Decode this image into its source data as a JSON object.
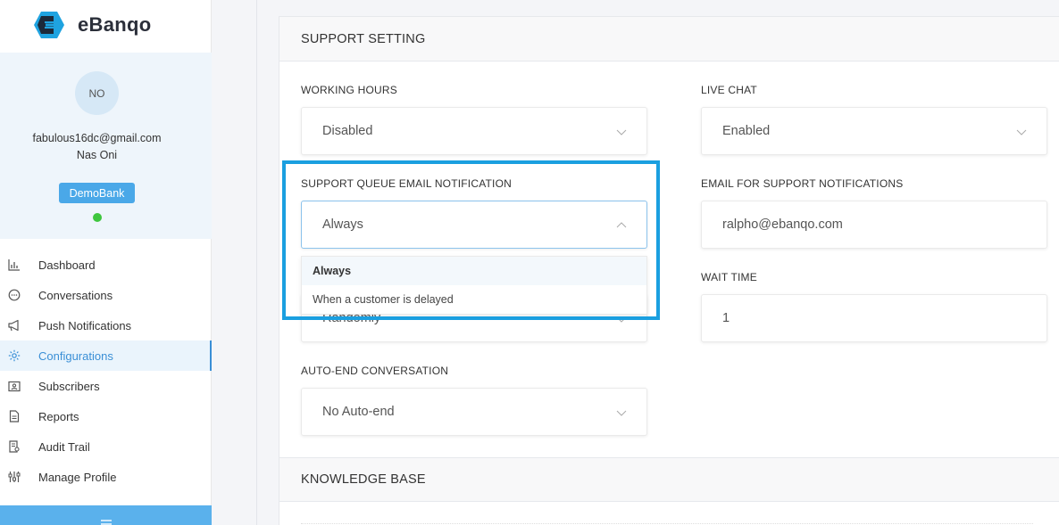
{
  "brand": {
    "name": "eBanqo"
  },
  "profile": {
    "initials": "NO",
    "email": "fabulous16dc@gmail.com",
    "name": "Nas Oni",
    "bank": "DemoBank",
    "status_color": "#3ec63e"
  },
  "nav": {
    "items": [
      {
        "label": "Dashboard",
        "icon": "bar-chart-icon"
      },
      {
        "label": "Conversations",
        "icon": "chat-bubble-icon"
      },
      {
        "label": "Push Notifications",
        "icon": "megaphone-icon"
      },
      {
        "label": "Configurations",
        "icon": "gear-icon",
        "active": true
      },
      {
        "label": "Subscribers",
        "icon": "contact-card-icon"
      },
      {
        "label": "Reports",
        "icon": "document-icon"
      },
      {
        "label": "Audit Trail",
        "icon": "audit-icon"
      },
      {
        "label": "Manage Profile",
        "icon": "sliders-icon"
      }
    ]
  },
  "support": {
    "title": "SUPPORT SETTING",
    "working_hours": {
      "label": "WORKING HOURS",
      "value": "Disabled"
    },
    "live_chat": {
      "label": "LIVE CHAT",
      "value": "Enabled"
    },
    "queue_email": {
      "label": "SUPPORT QUEUE EMAIL NOTIFICATION",
      "value": "Always",
      "options": [
        "Always",
        "When a customer is delayed"
      ]
    },
    "email_notifications": {
      "label": "EMAIL FOR SUPPORT NOTIFICATIONS",
      "value": "ralpho@ebanqo.com"
    },
    "routing": {
      "value": "Randomly"
    },
    "wait_time": {
      "label": "WAIT TIME",
      "value": "1"
    },
    "auto_end": {
      "label": "AUTO-END CONVERSATION",
      "value": "No Auto-end"
    }
  },
  "knowledge_base": {
    "title": "KNOWLEDGE BASE"
  },
  "colors": {
    "accent": "#3a8fd6",
    "highlight": "#1a9fe0",
    "badge": "#4aa8e8"
  }
}
